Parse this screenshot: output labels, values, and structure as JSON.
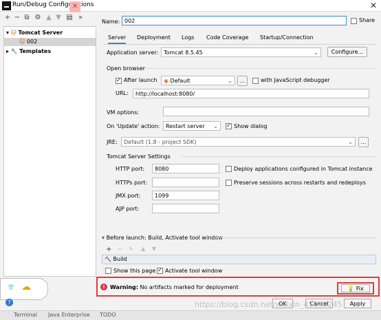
{
  "window": {
    "title": "Run/Debug Configurations"
  },
  "left_toolbar": [
    "add",
    "remove",
    "copy",
    "wrench",
    "up",
    "down",
    "folder",
    "more"
  ],
  "tree": {
    "tomcat_server": "Tomcat Server",
    "config_002": "002",
    "templates": "Templates"
  },
  "header": {
    "name_label": "Name:",
    "name_value": "002",
    "share_label": "Share"
  },
  "tabs": [
    "Server",
    "Deployment",
    "Logs",
    "Code Coverage",
    "Startup/Connection"
  ],
  "server": {
    "app_server_label": "Application server:",
    "app_server_value": "Tomcat 8.5.45",
    "configure_label": "Configure...",
    "open_browser_label": "Open browser",
    "after_launch_label": "After launch",
    "browser_value": "Default",
    "dots_label": "...",
    "js_debugger_label": "with JavaScript debugger",
    "url_label": "URL:",
    "url_value": "http://localhost:8080/",
    "vm_options_label": "VM options:",
    "on_update_label": "On 'Update' action:",
    "on_update_value": "Restart server",
    "show_dialog_label": "Show dialog",
    "jre_label": "JRE:",
    "jre_value": "Default (1.8 - project SDK)",
    "tomcat_settings_label": "Tomcat Server Settings",
    "http_port_label": "HTTP port:",
    "http_port_value": "8080",
    "https_port_label": "HTTPs port:",
    "https_port_value": "",
    "jmx_port_label": "JMX port:",
    "jmx_port_value": "1099",
    "ajp_port_label": "AJP port:",
    "ajp_port_value": "",
    "deploy_label": "Deploy applications configured in Tomcat instance",
    "preserve_label": "Preserve sessions across restarts and redeploys"
  },
  "before_launch": {
    "label": "Before launch: Build, Activate tool window",
    "build_item": "Build",
    "show_page_label": "Show this page",
    "activate_label": "Activate tool window"
  },
  "warning": {
    "prefix": "Warning:",
    "text": "No artifacts marked for deployment",
    "fix_label": "Fix"
  },
  "footer": {
    "ok": "OK",
    "cancel": "Cancel",
    "apply": "Apply",
    "help": "?"
  },
  "watermark": "https://blog.csdn.net/weixin_45590245",
  "statusbar": [
    "Terminal",
    "Java Enterprise",
    "TODO"
  ],
  "colors": {
    "accent": "#4083c9",
    "warning_border": "#e03a3a",
    "background": "#f2f2f2"
  }
}
